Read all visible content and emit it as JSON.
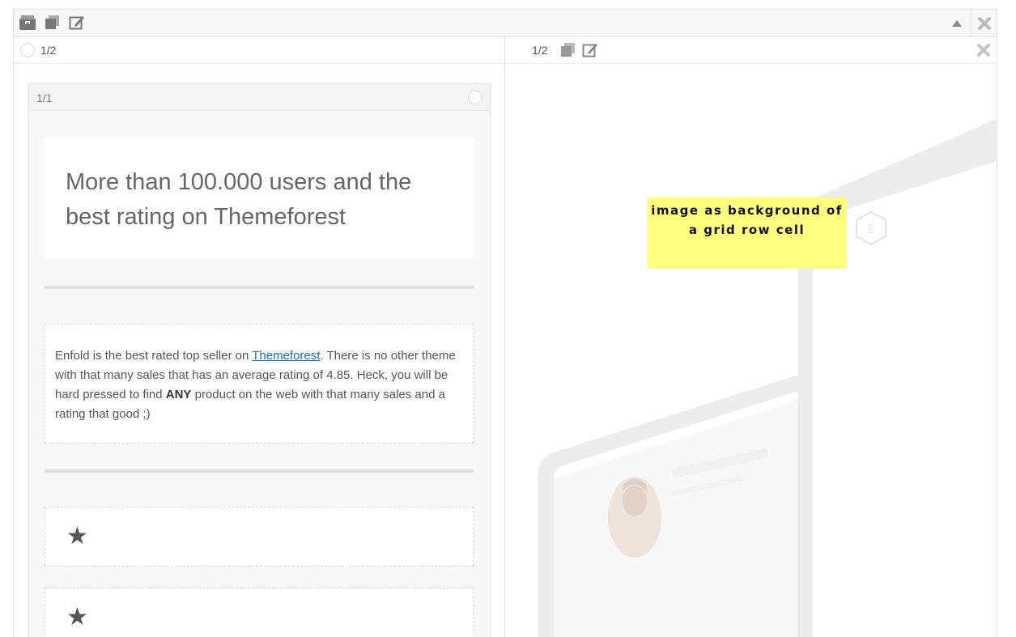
{
  "row": {
    "toolbar_icons": [
      "archive-icon",
      "copy-icon",
      "edit-icon"
    ],
    "right_icons": [
      "collapse-arrow-icon",
      "close-icon"
    ]
  },
  "cells": [
    {
      "size_label": "1/2",
      "column": {
        "size_label": "1/1",
        "heading": "More than 100.000 users and the best rating on Themeforest",
        "text": {
          "before_link": "Enfold is the best rated top seller on ",
          "link": "Themeforest",
          "middle": ". There is no other theme with that many sales that has an average rating of 4.85. Heck, you will be hard pressed to find ",
          "bold": "ANY",
          "after": " product on the web with that many sales and a rating that good ;)"
        },
        "icons": [
          "★",
          "★"
        ]
      }
    },
    {
      "size_label": "1/2",
      "note": "image as background of a grid row cell"
    }
  ],
  "colors": {
    "accent_link": "#1b6ea8",
    "note_background": "#ffff80"
  }
}
